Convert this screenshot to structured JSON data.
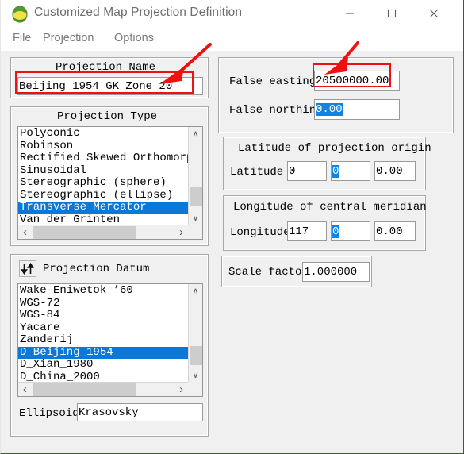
{
  "window": {
    "title": "Customized Map Projection Definition",
    "icon": "globe-icon",
    "minimize_label": "—",
    "maximize_label": "□",
    "close_label": "✕",
    "accent_red": "#ee1111",
    "selection_blue": "#0a78d8",
    "face_color": "#f0f0f0"
  },
  "menu": {
    "items": [
      {
        "label": "File"
      },
      {
        "label": "Projection"
      },
      {
        "label": "Options"
      }
    ]
  },
  "projection_name": {
    "caption": "Projection Name",
    "value": "Beijing_1954_GK_Zone_20",
    "highlighted": true
  },
  "projection_type": {
    "caption": "Projection Type",
    "items": [
      {
        "label": "Polyconic",
        "selected": false
      },
      {
        "label": "Robinson",
        "selected": false
      },
      {
        "label": "Rectified Skewed Orthomorphi",
        "selected": false
      },
      {
        "label": "Sinusoidal",
        "selected": false
      },
      {
        "label": "Stereographic (sphere)",
        "selected": false
      },
      {
        "label": "Stereographic (ellipse)",
        "selected": false
      },
      {
        "label": "Transverse Mercator",
        "selected": true
      },
      {
        "label": "Van der Grinten",
        "selected": false
      }
    ],
    "scroll_up_glyph": "∧",
    "scroll_down_glyph": "∨",
    "scroll_left_glyph": "‹",
    "scroll_right_glyph": "›"
  },
  "projection_datum": {
    "caption": "Projection Datum",
    "icon": "sort-arrows-icon",
    "items": [
      {
        "label": "Wake-Eniwetok ’60",
        "selected": false
      },
      {
        "label": "WGS-72",
        "selected": false
      },
      {
        "label": "WGS-84",
        "selected": false
      },
      {
        "label": "Yacare",
        "selected": false
      },
      {
        "label": "Zanderij",
        "selected": false
      },
      {
        "label": "D_Beijing_1954",
        "selected": true
      },
      {
        "label": "D_Xian_1980",
        "selected": false
      },
      {
        "label": "D_China_2000",
        "selected": false
      }
    ],
    "scroll_up_glyph": "∧",
    "scroll_down_glyph": "∨",
    "scroll_left_glyph": "‹",
    "scroll_right_glyph": "›"
  },
  "ellipsoid": {
    "label": "Ellipsoid",
    "value": "Krasovsky"
  },
  "false_offsets": {
    "easting_label": "False easting",
    "easting_value": "20500000.00",
    "easting_highlighted": true,
    "northing_label": "False northing",
    "northing_value": "0.00",
    "northing_selected": true
  },
  "latitude_origin": {
    "caption": "Latitude of projection origin",
    "label": "Latitude",
    "degrees": "0",
    "minutes": "0",
    "minutes_selected": true,
    "seconds": "0.00"
  },
  "longitude_meridian": {
    "caption": "Longitude of central meridian",
    "label": "Longitude",
    "degrees": "117",
    "minutes": "0",
    "minutes_selected": true,
    "seconds": "0.00"
  },
  "scale_factor": {
    "label": "Scale factor",
    "value": "1.000000"
  },
  "annotations": {
    "arrow_projection_name": "red-arrow-down-left",
    "arrow_false_easting": "red-arrow-down-left",
    "rect_projection_name": "red-highlight-rect",
    "rect_false_easting": "red-highlight-rect"
  }
}
